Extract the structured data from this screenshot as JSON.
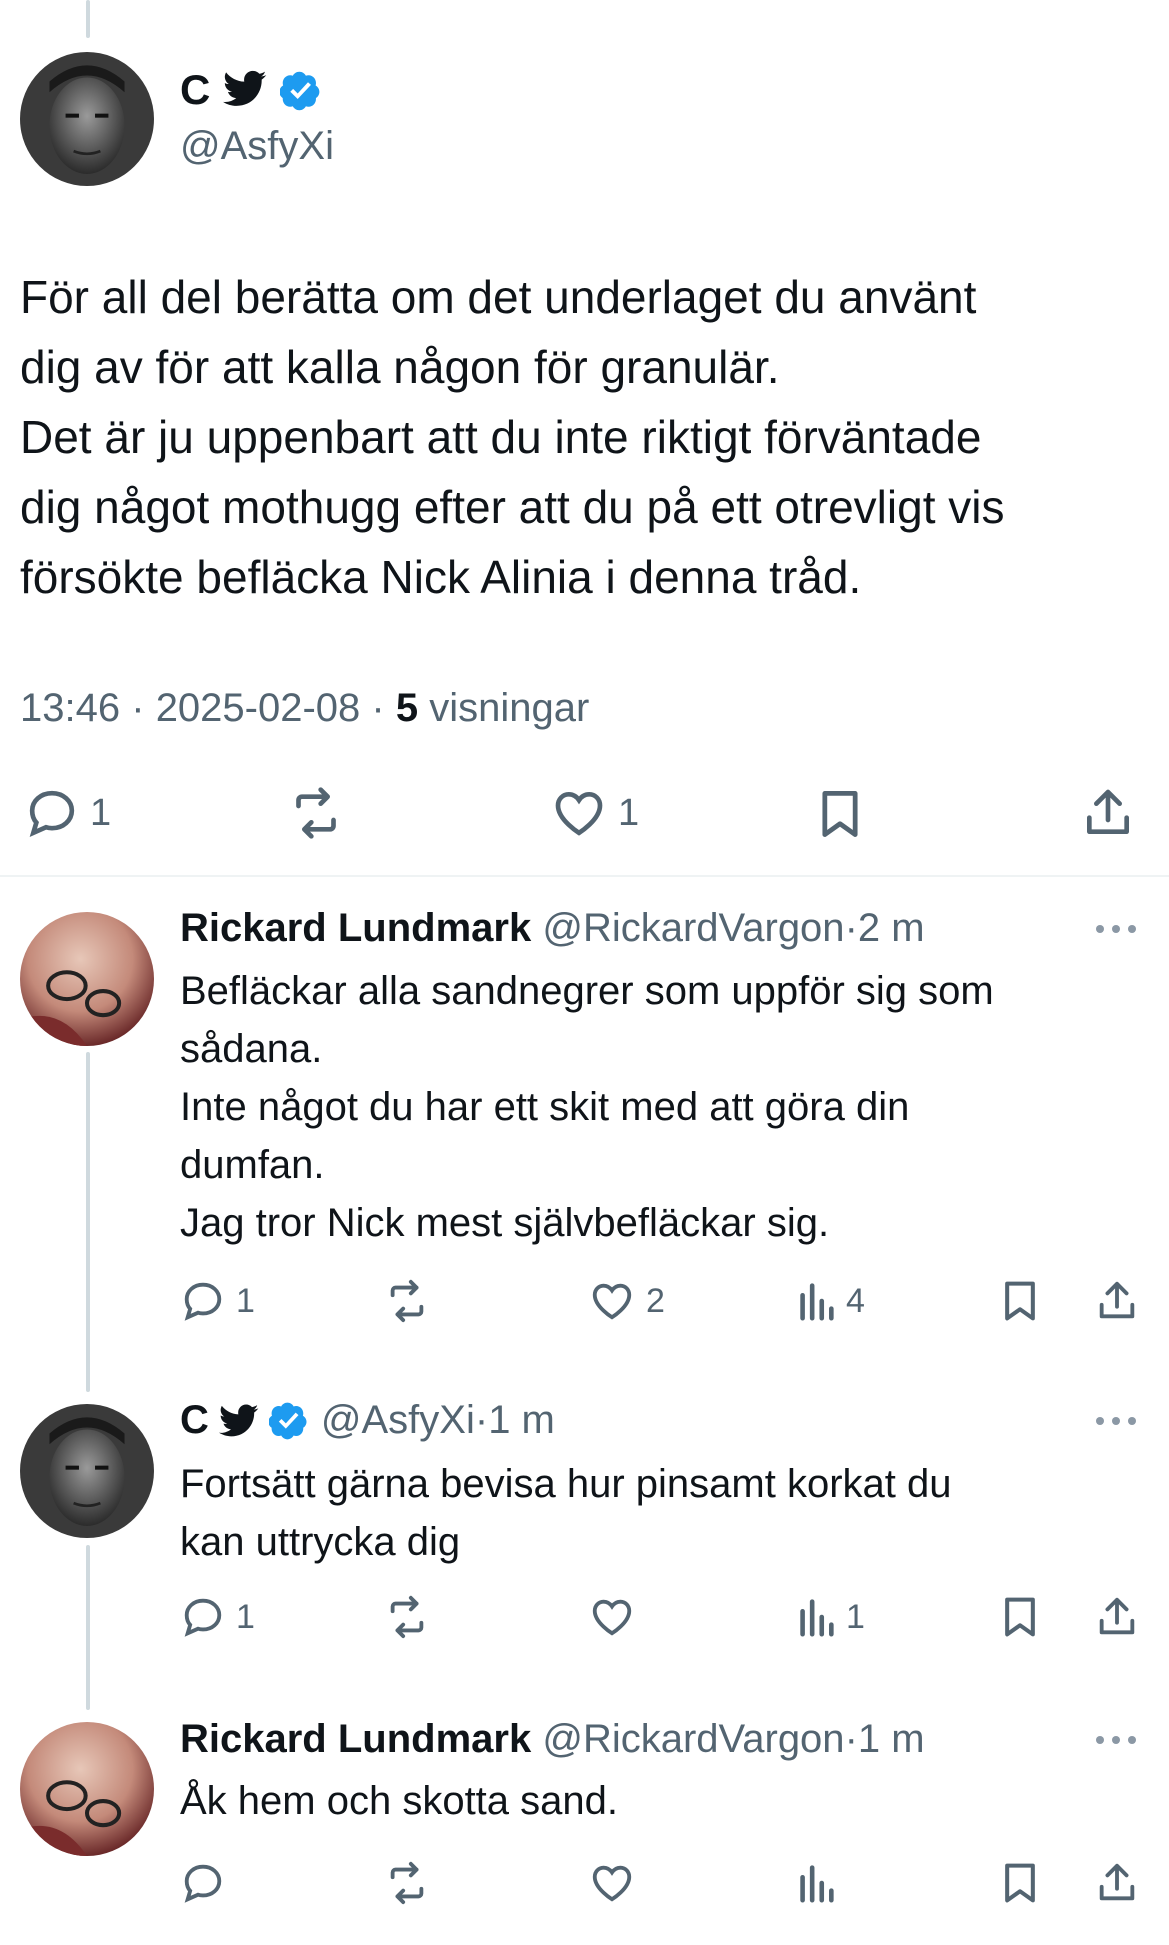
{
  "main_tweet": {
    "display_name": "C",
    "handle": "@AsfyXi",
    "text": "För all del berätta om det underlaget du använt\ndig av för att kalla någon för granulär.\nDet är ju uppenbart att du inte riktigt förväntade\ndig något mothugg efter att du på ett otrevligt vis\nförsökte befläcka Nick Alinia i denna tråd.",
    "time": "13:46",
    "sep1": "·",
    "date": "2025-02-08",
    "sep2": "·",
    "views_count": "5",
    "views_label": "visningar",
    "replies": "1",
    "likes": "1"
  },
  "replies": [
    {
      "display_name": "Rickard Lundmark",
      "handle": "@RickardVargon",
      "sep": "·",
      "time": "2 m",
      "text": "Befläckar alla sandnegrer som uppför sig som\nsådana.\nInte något du har ett skit med att göra din\ndumfan.\nJag tror Nick mest självbefläckar sig.",
      "replies": "1",
      "likes": "2",
      "views": "4"
    },
    {
      "display_name": "C",
      "handle": "@AsfyXi",
      "sep": "·",
      "time": "1 m",
      "text": "Fortsätt gärna bevisa hur pinsamt korkat du\nkan uttrycka dig",
      "replies": "1",
      "likes": "",
      "views": "1"
    },
    {
      "display_name": "Rickard Lundmark",
      "handle": "@RickardVargon",
      "sep": "·",
      "time": "1 m",
      "text": "Åk hem och skotta sand.",
      "replies": "",
      "likes": "",
      "views": ""
    }
  ],
  "icons": {
    "reply": "reply-icon",
    "retweet": "retweet-icon",
    "like": "heart-icon",
    "views": "views-icon",
    "bookmark": "bookmark-icon",
    "share": "share-icon",
    "more": "more-icon",
    "verified": "verified-badge-icon",
    "bird": "bird-icon"
  },
  "colors": {
    "text": "#0f1419",
    "secondary": "#536471",
    "verified": "#1d9bf0",
    "line": "#cfd9de"
  }
}
